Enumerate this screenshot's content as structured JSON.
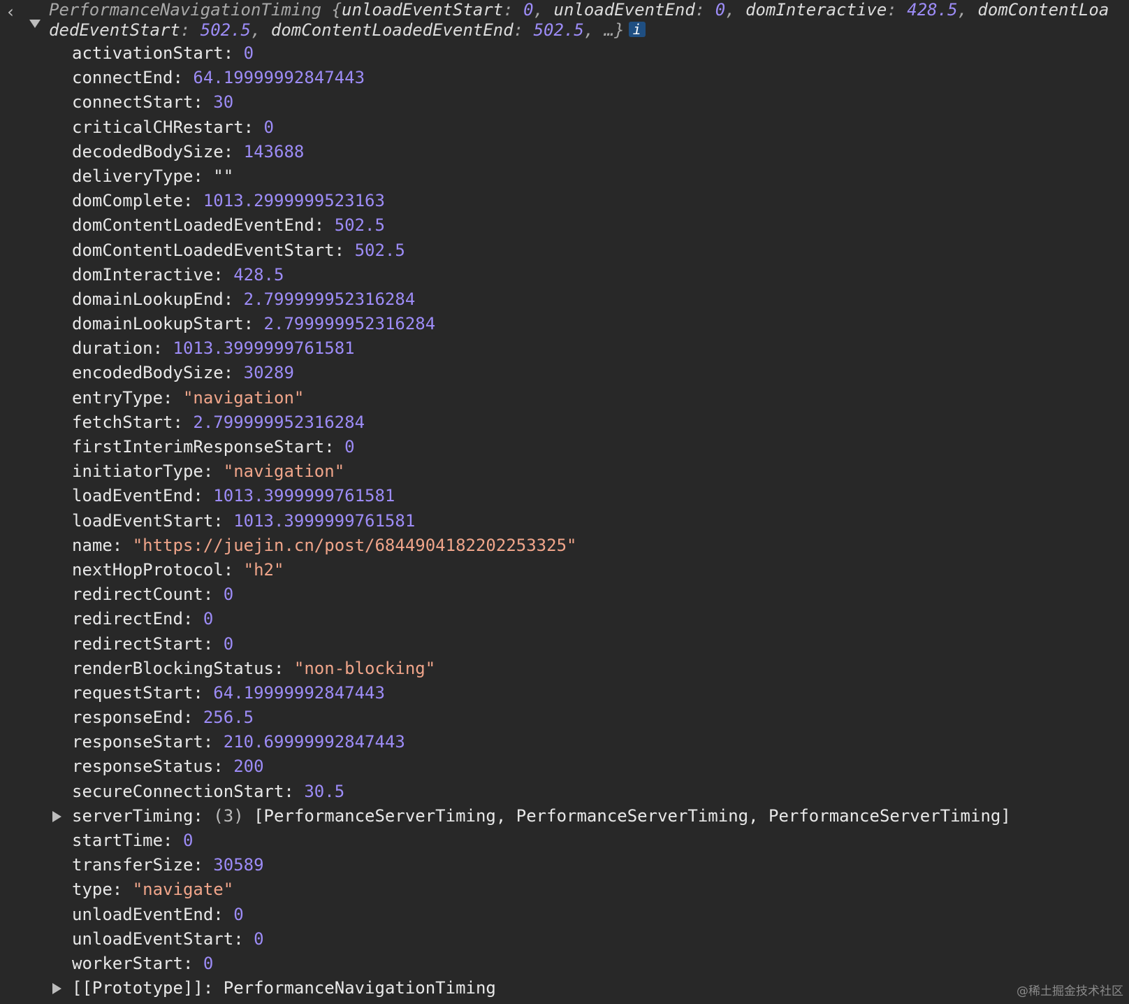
{
  "header": {
    "back_icon_glyph": "‹",
    "object_type": "PerformanceNavigationTiming",
    "open_brace": " {",
    "preview": [
      {
        "key": "unloadEventStart",
        "value": "0"
      },
      {
        "key": "unloadEventEnd",
        "value": "0"
      },
      {
        "key": "domInteractive",
        "value": "428.5"
      },
      {
        "key": "domContentLoadedEventStart",
        "value": "502.5"
      },
      {
        "key": "domContentLoadedEventEnd",
        "value": "502.5"
      }
    ],
    "ellipsis": "…}",
    "info_label": "i"
  },
  "properties": [
    {
      "key": "activationStart",
      "value": "0",
      "kind": "num"
    },
    {
      "key": "connectEnd",
      "value": "64.19999992847443",
      "kind": "num"
    },
    {
      "key": "connectStart",
      "value": "30",
      "kind": "num"
    },
    {
      "key": "criticalCHRestart",
      "value": "0",
      "kind": "num"
    },
    {
      "key": "decodedBodySize",
      "value": "143688",
      "kind": "num"
    },
    {
      "key": "deliveryType",
      "value": "\"\"",
      "kind": "plain"
    },
    {
      "key": "domComplete",
      "value": "1013.2999999523163",
      "kind": "num"
    },
    {
      "key": "domContentLoadedEventEnd",
      "value": "502.5",
      "kind": "num"
    },
    {
      "key": "domContentLoadedEventStart",
      "value": "502.5",
      "kind": "num"
    },
    {
      "key": "domInteractive",
      "value": "428.5",
      "kind": "num"
    },
    {
      "key": "domainLookupEnd",
      "value": "2.799999952316284",
      "kind": "num"
    },
    {
      "key": "domainLookupStart",
      "value": "2.799999952316284",
      "kind": "num"
    },
    {
      "key": "duration",
      "value": "1013.3999999761581",
      "kind": "num"
    },
    {
      "key": "encodedBodySize",
      "value": "30289",
      "kind": "num"
    },
    {
      "key": "entryType",
      "value": "\"navigation\"",
      "kind": "str"
    },
    {
      "key": "fetchStart",
      "value": "2.799999952316284",
      "kind": "num"
    },
    {
      "key": "firstInterimResponseStart",
      "value": "0",
      "kind": "num"
    },
    {
      "key": "initiatorType",
      "value": "\"navigation\"",
      "kind": "str"
    },
    {
      "key": "loadEventEnd",
      "value": "1013.3999999761581",
      "kind": "num"
    },
    {
      "key": "loadEventStart",
      "value": "1013.3999999761581",
      "kind": "num"
    },
    {
      "key": "name",
      "value": "\"https://juejin.cn/post/6844904182202253325\"",
      "kind": "str"
    },
    {
      "key": "nextHopProtocol",
      "value": "\"h2\"",
      "kind": "str"
    },
    {
      "key": "redirectCount",
      "value": "0",
      "kind": "num"
    },
    {
      "key": "redirectEnd",
      "value": "0",
      "kind": "num"
    },
    {
      "key": "redirectStart",
      "value": "0",
      "kind": "num"
    },
    {
      "key": "renderBlockingStatus",
      "value": "\"non-blocking\"",
      "kind": "str"
    },
    {
      "key": "requestStart",
      "value": "64.19999992847443",
      "kind": "num"
    },
    {
      "key": "responseEnd",
      "value": "256.5",
      "kind": "num"
    },
    {
      "key": "responseStart",
      "value": "210.69999992847443",
      "kind": "num"
    },
    {
      "key": "responseStatus",
      "value": "200",
      "kind": "num"
    },
    {
      "key": "secureConnectionStart",
      "value": "30.5",
      "kind": "num"
    },
    {
      "key": "serverTiming",
      "count": "(3)",
      "value": "[PerformanceServerTiming, PerformanceServerTiming, PerformanceServerTiming]",
      "kind": "plain",
      "expandable": true
    },
    {
      "key": "startTime",
      "value": "0",
      "kind": "num"
    },
    {
      "key": "transferSize",
      "value": "30589",
      "kind": "num"
    },
    {
      "key": "type",
      "value": "\"navigate\"",
      "kind": "str"
    },
    {
      "key": "unloadEventEnd",
      "value": "0",
      "kind": "num"
    },
    {
      "key": "unloadEventStart",
      "value": "0",
      "kind": "num"
    },
    {
      "key": "workerStart",
      "value": "0",
      "kind": "num"
    },
    {
      "key": "[[Prototype]]",
      "value": "PerformanceNavigationTiming",
      "kind": "plain",
      "expandable": true
    }
  ],
  "watermark": "@稀土掘金技术社区",
  "colors": {
    "background": "#282828",
    "key": "#e8e8e8",
    "number": "#9d8cf7",
    "string": "#f0a58a",
    "info_badge": "#1f4f82"
  }
}
